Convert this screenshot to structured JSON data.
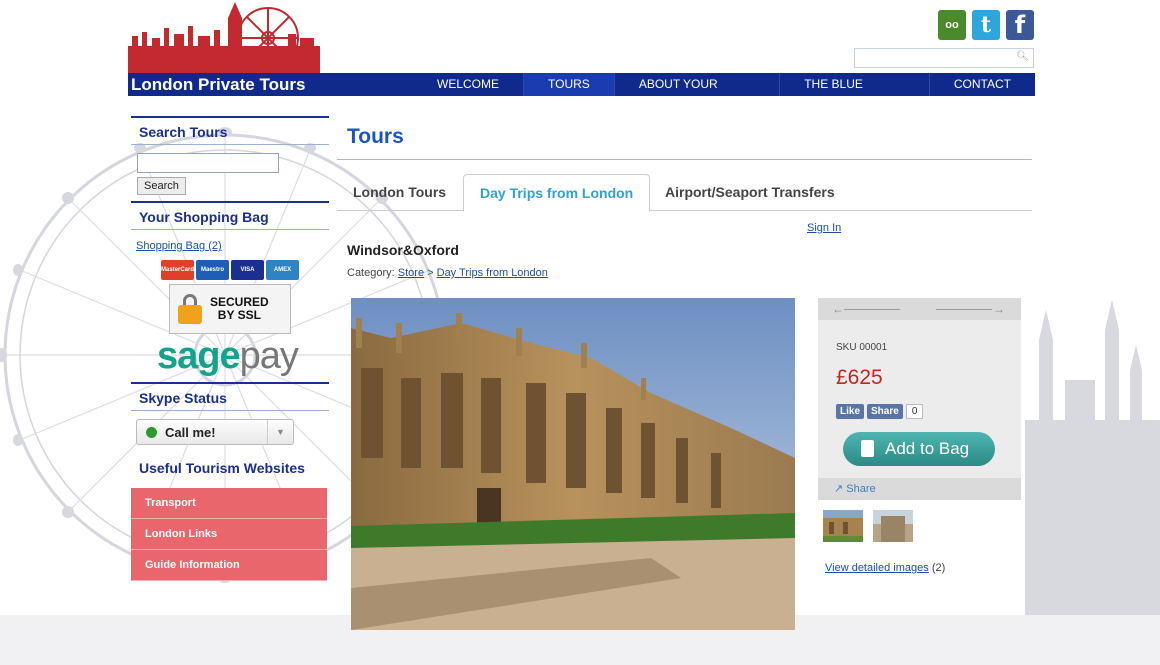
{
  "header": {
    "site_title": "London Private Tours",
    "social": [
      "tripadvisor-icon",
      "twitter-icon",
      "facebook-icon"
    ],
    "search_placeholder": ""
  },
  "nav": {
    "items": [
      {
        "label": "WELCOME",
        "active": false
      },
      {
        "label": "TOURS",
        "active": true
      },
      {
        "label": "ABOUT YOUR GUIDE",
        "active": false
      },
      {
        "label": "THE BLUE BADGE",
        "active": false
      },
      {
        "label": "CONTACT",
        "active": false
      }
    ]
  },
  "sidebar": {
    "search_heading": "Search Tours",
    "search_button": "Search",
    "bag_heading": "Your Shopping Bag",
    "bag_link": "Shopping Bag",
    "bag_count": "(2)",
    "cards": [
      "MasterCard",
      "Maestro",
      "VISA",
      "AMEX"
    ],
    "ssl_line1": "SECURED",
    "ssl_line2": "BY SSL",
    "sage": "sage",
    "pay": "pay",
    "skype_heading": "Skype Status",
    "skype_button": "Call me!",
    "useful_heading": "Useful Tourism Websites",
    "links": [
      "Transport",
      "London Links",
      "Guide Information"
    ]
  },
  "main": {
    "page_title": "Tours",
    "tabs": [
      {
        "label": "London Tours",
        "active": false
      },
      {
        "label": "Day Trips from London",
        "active": true
      },
      {
        "label": "Airport/Seaport Transfers",
        "active": false
      }
    ],
    "sign_in": "Sign In",
    "product_name": "Windsor&Oxford",
    "category_label": "Category:",
    "category_store": "Store",
    "category_sep": ">",
    "category_sub": "Day Trips from London"
  },
  "purchase": {
    "sku": "SKU 00001",
    "price": "£625",
    "fb_like": "Like",
    "fb_share": "Share",
    "fb_count": "0",
    "add_to_bag": "Add to Bag",
    "share": "Share",
    "detailed_link": "View detailed images",
    "detailed_count": "(2)"
  },
  "colors": {
    "navy": "#0f2a8a",
    "title_blue": "#1a55c0",
    "tab_active": "#2ea0d8",
    "price_red": "#c0281e",
    "pink_menu": "#e8666c",
    "teal_button": "#2a8a86"
  }
}
